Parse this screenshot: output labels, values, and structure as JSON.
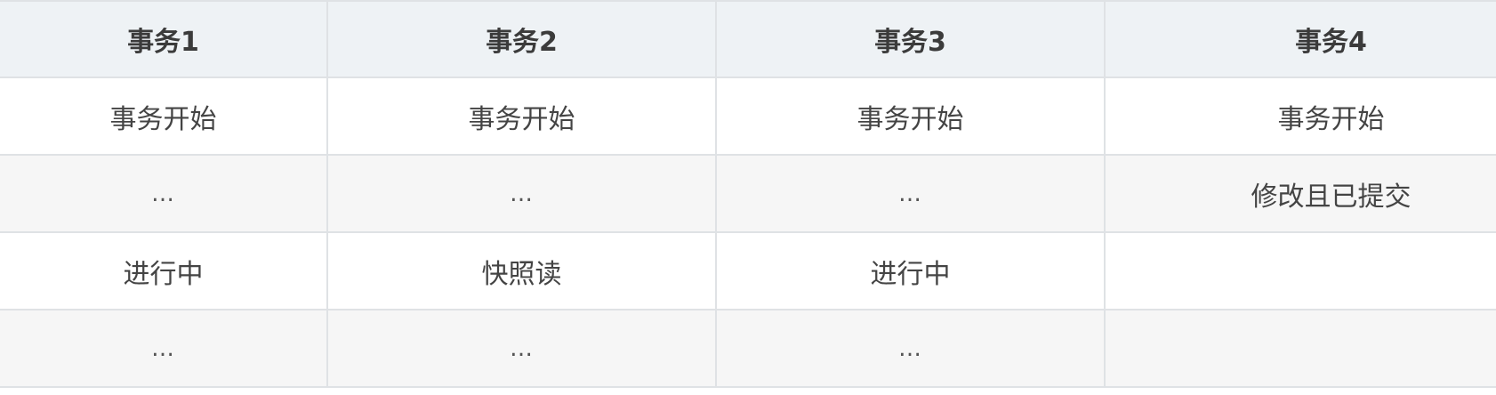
{
  "table": {
    "headers": [
      "事务1",
      "事务2",
      "事务3",
      "事务4"
    ],
    "rows": [
      [
        "事务开始",
        "事务开始",
        "事务开始",
        "事务开始"
      ],
      [
        "…",
        "…",
        "…",
        "修改且已提交"
      ],
      [
        "进行中",
        "快照读",
        "进行中",
        ""
      ],
      [
        "…",
        "…",
        "…",
        ""
      ]
    ]
  }
}
